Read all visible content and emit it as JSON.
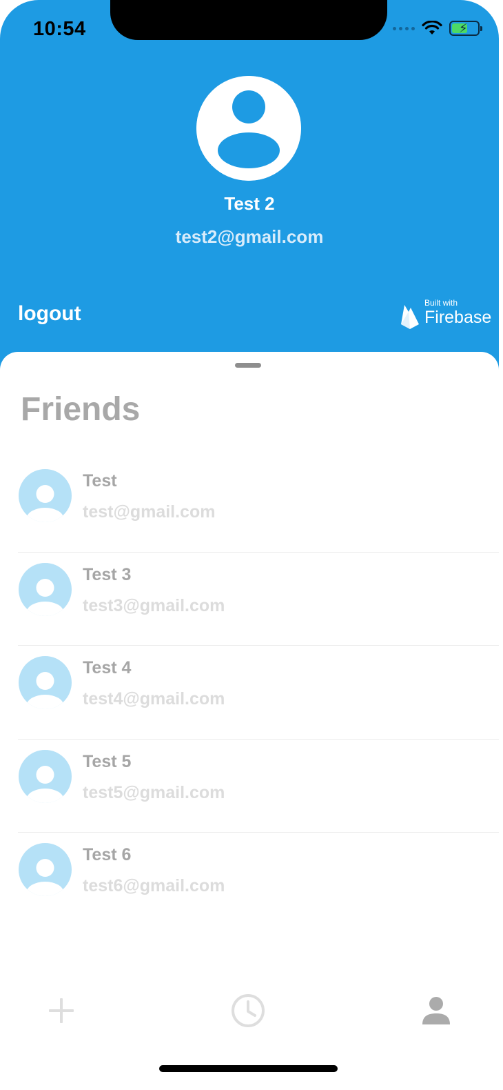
{
  "status_bar": {
    "time": "10:54"
  },
  "profile": {
    "name": "Test 2",
    "email": "test2@gmail.com",
    "avatar_icon": "user-avatar-icon"
  },
  "header": {
    "logout_label": "logout",
    "firebase_badge": {
      "built_with": "Built with",
      "name": "Firebase"
    },
    "background_color": "#1e9be3"
  },
  "friends": {
    "title": "Friends",
    "items": [
      {
        "name": "Test",
        "email": "test@gmail.com"
      },
      {
        "name": "Test 3",
        "email": "test3@gmail.com"
      },
      {
        "name": "Test 4",
        "email": "test4@gmail.com"
      },
      {
        "name": "Test 5",
        "email": "test5@gmail.com"
      },
      {
        "name": "Test 6",
        "email": "test6@gmail.com"
      }
    ]
  },
  "tab_bar": {
    "tabs": [
      {
        "icon": "plus-icon",
        "active": false
      },
      {
        "icon": "clock-icon",
        "active": false
      },
      {
        "icon": "person-icon",
        "active": true
      }
    ]
  }
}
